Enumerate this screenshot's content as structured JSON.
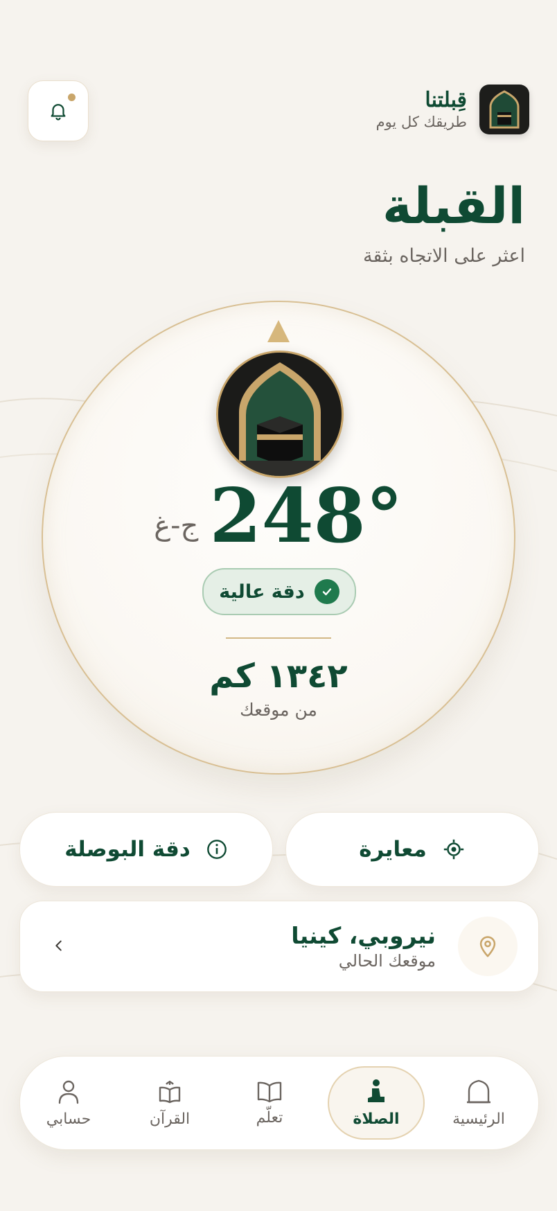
{
  "header": {
    "brand_name": "قِبلتنا",
    "brand_tagline": "طريقك كل يوم",
    "notification_badge_color": "#c9a66b"
  },
  "page": {
    "title": "القبلة",
    "subtitle": "اعثر على الاتجاه بثقة"
  },
  "compass": {
    "bearing_value": "248°",
    "bearing_direction": "ج-غ",
    "accuracy_label": "دقة عالية",
    "distance_value": "١٣٤٢ كم",
    "distance_caption": "من موقعك"
  },
  "actions": {
    "calibrate_label": "معايرة",
    "compass_accuracy_label": "دقة البوصلة"
  },
  "location": {
    "city": "نيروبي، كينيا",
    "caption": "موقعك الحالي"
  },
  "nav": {
    "items": [
      {
        "label": "الرئيسية",
        "icon": "home-icon"
      },
      {
        "label": "الصلاة",
        "icon": "prayer-icon",
        "active": true
      },
      {
        "label": "تعلّم",
        "icon": "book-icon"
      },
      {
        "label": "القرآن",
        "icon": "quran-icon"
      },
      {
        "label": "حسابي",
        "icon": "profile-icon"
      }
    ]
  },
  "colors": {
    "primary_green": "#0f4a33",
    "gold_accent": "#c9a66b",
    "background": "#f6f3ee",
    "success": "#1f7a4d"
  }
}
